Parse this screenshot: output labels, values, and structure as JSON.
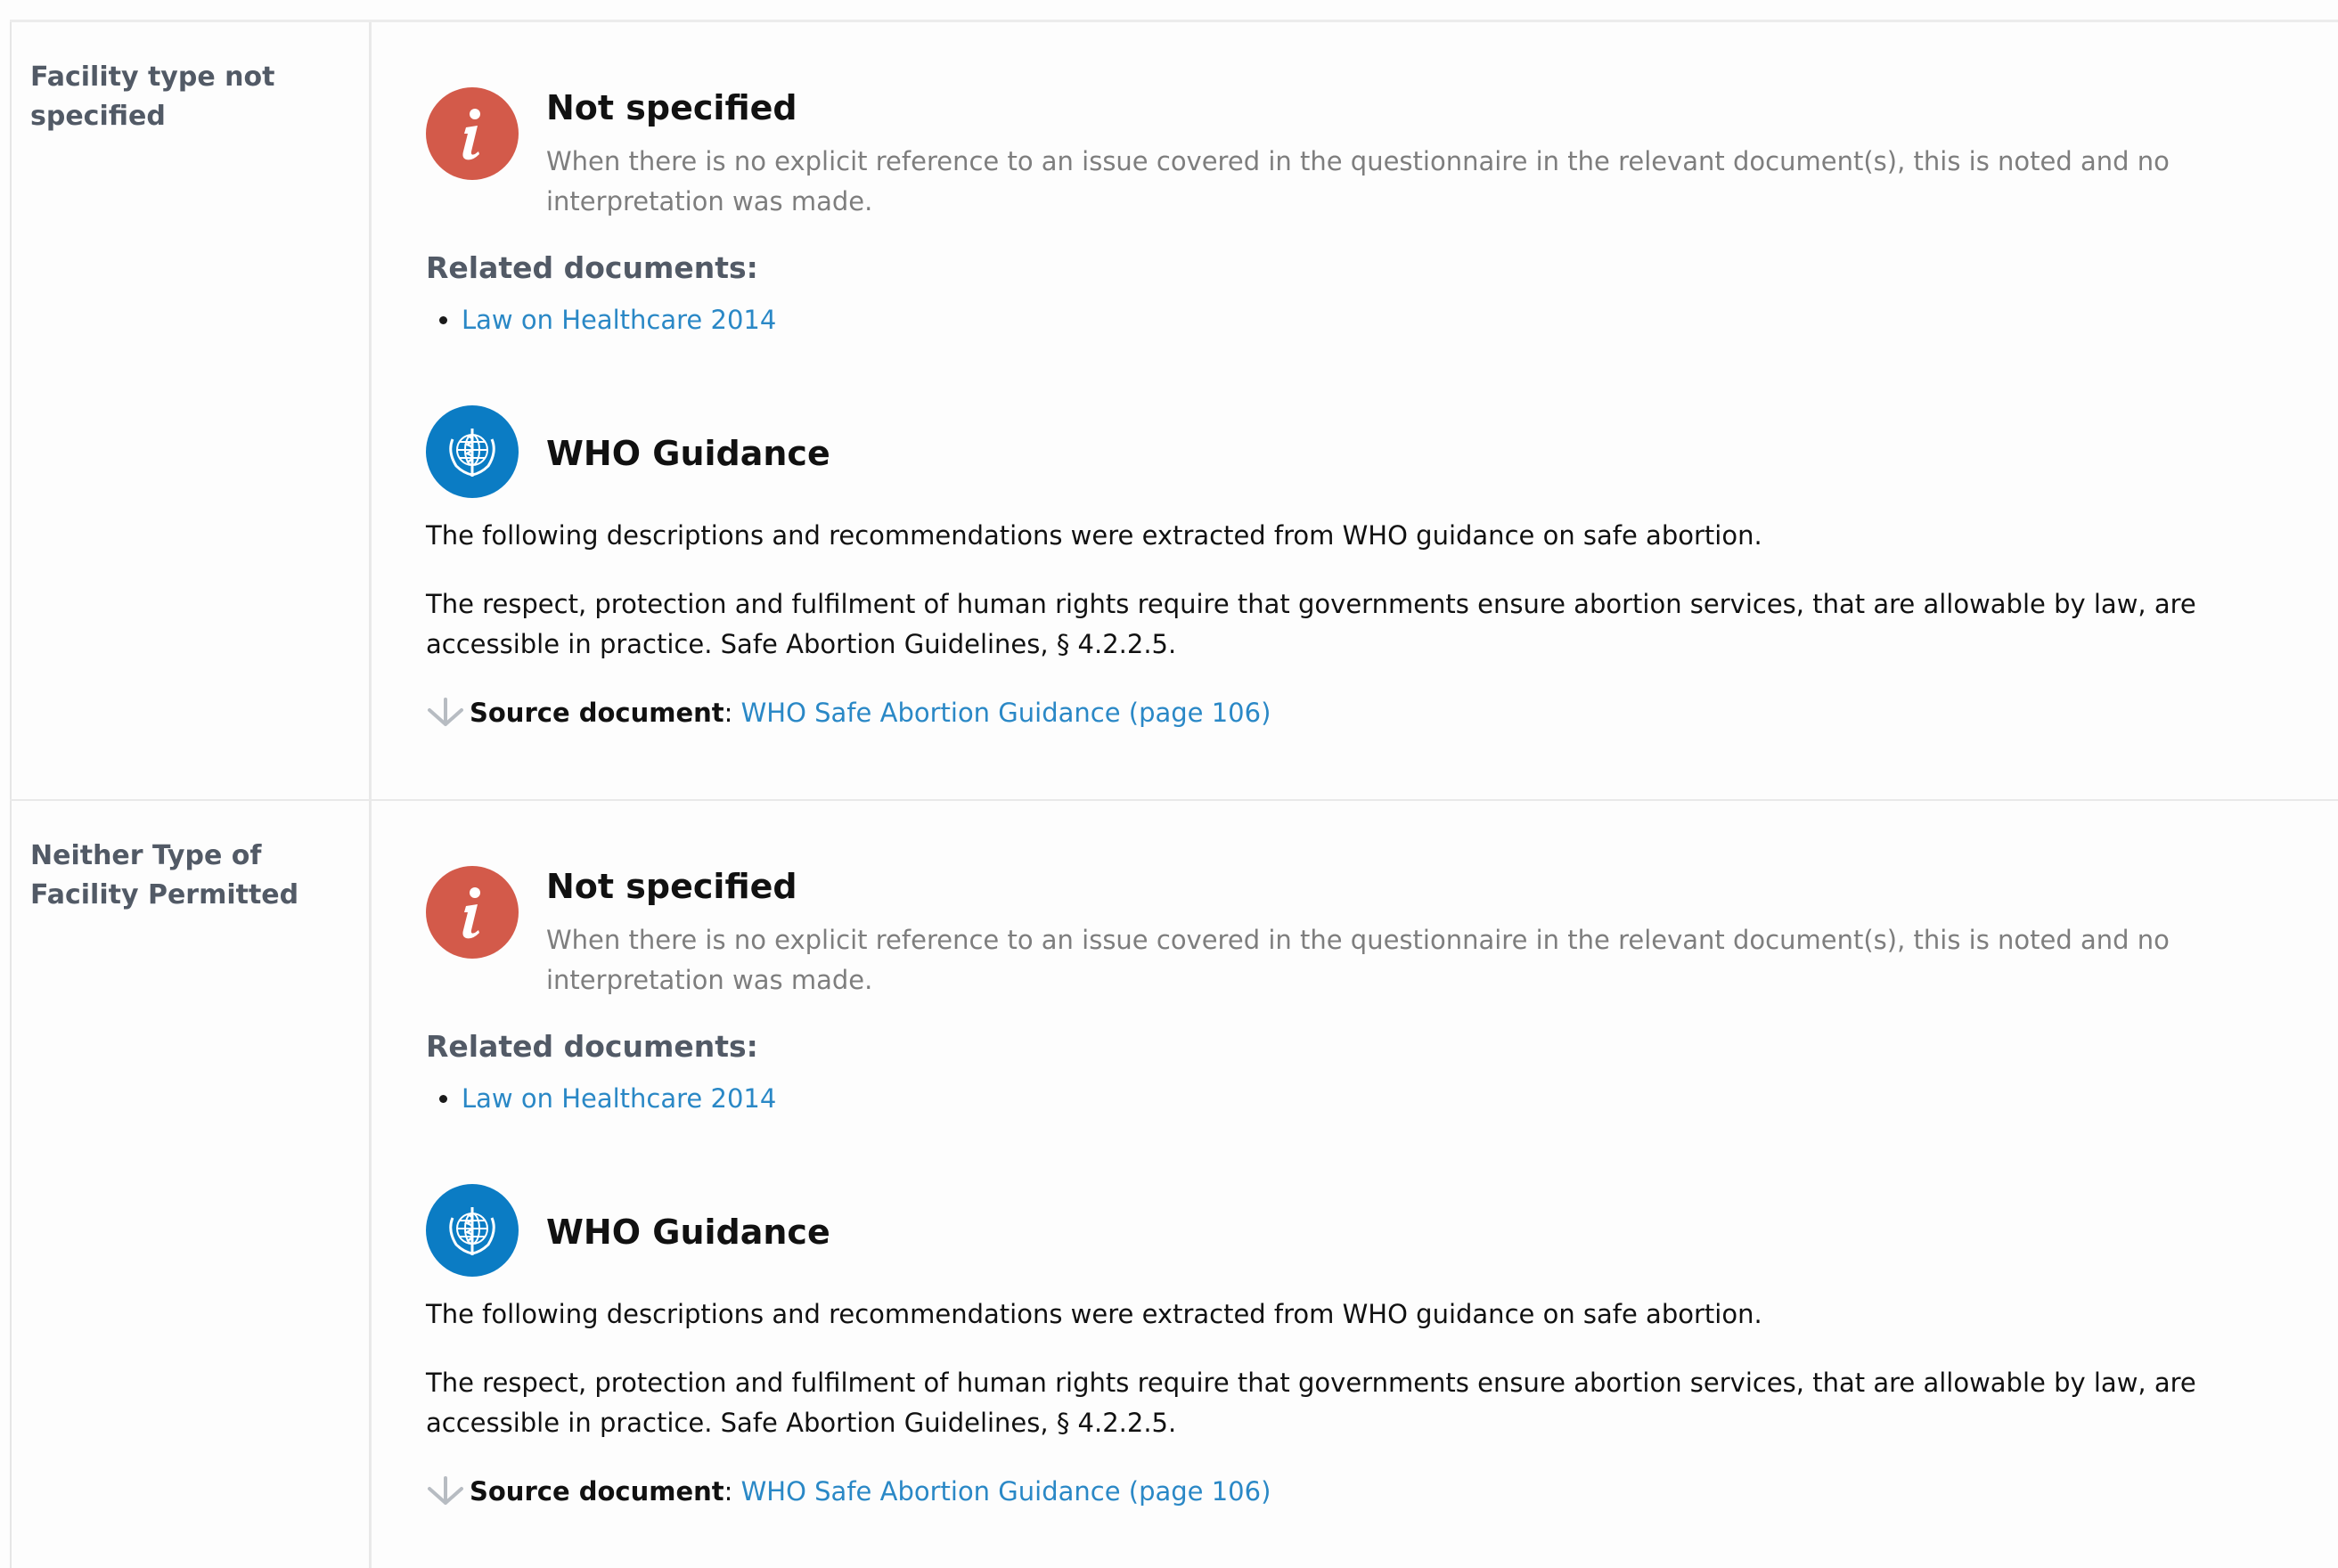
{
  "rows": [
    {
      "label": "Facility type not specified",
      "status": {
        "icon": "info-icon",
        "title": "Not specified",
        "description": "When there is no explicit reference to an issue covered in the questionnaire in the relevant document(s), this is noted and no interpretation was made."
      },
      "related_heading": "Related documents:",
      "related_documents": [
        "Law on Healthcare 2014"
      ],
      "guidance": {
        "icon": "who-emblem-icon",
        "title": "WHO Guidance",
        "intro": "The following descriptions and recommendations were extracted from WHO guidance on safe abortion.",
        "quote": "The respect, protection and fulfilment of human rights require that governments ensure abortion services, that are allowable by law, are accessible in practice. Safe Abortion Guidelines, § 4.2.2.5.",
        "source_label": "Source document",
        "source_separator": ":",
        "source_link": "WHO Safe Abortion Guidance (page 106)"
      }
    },
    {
      "label": "Neither Type of Facility Permitted",
      "status": {
        "icon": "info-icon",
        "title": "Not specified",
        "description": "When there is no explicit reference to an issue covered in the questionnaire in the relevant document(s), this is noted and no interpretation was made."
      },
      "related_heading": "Related documents:",
      "related_documents": [
        "Law on Healthcare 2014"
      ],
      "guidance": {
        "icon": "who-emblem-icon",
        "title": "WHO Guidance",
        "intro": "The following descriptions and recommendations were extracted from WHO guidance on safe abortion.",
        "quote": "The respect, protection and fulfilment of human rights require that governments ensure abortion services, that are allowable by law, are accessible in practice. Safe Abortion Guidelines, § 4.2.2.5.",
        "source_label": "Source document",
        "source_separator": ":",
        "source_link": "WHO Safe Abortion Guidance (page 106)"
      }
    }
  ],
  "colors": {
    "info_icon_bg": "#d35a4a",
    "who_icon_bg": "#0b7cc4",
    "link": "#2a88c6",
    "label_text": "#525a66",
    "muted_text": "#7e7e7e"
  }
}
